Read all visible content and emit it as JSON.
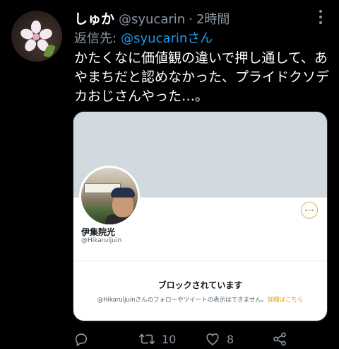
{
  "tweet": {
    "author_name": "しゅか",
    "author_handle": "@syucarin",
    "separator": "·",
    "time": "2時間",
    "reply_label": "返信先:",
    "reply_to": "@syucarinさん",
    "text": "かたくなに価値観の違いで押し通して、あやまちだと認めなかった、プライドクソデカおじさんやった…。",
    "avatar_icon": "cherry-blossom-icon"
  },
  "card": {
    "profile_name": "伊集院光",
    "profile_handle": "@Hikaruljuin",
    "blocked_title": "ブロックされています",
    "blocked_desc": "@Hikaruljuinさんのフォローやツイートの表示はできません。",
    "blocked_link": "詳細はこちら"
  },
  "actions": {
    "reply_icon": "reply-icon",
    "retweet_icon": "retweet-icon",
    "retweet_count": "10",
    "like_icon": "heart-icon",
    "like_count": "8",
    "share_icon": "share-icon"
  },
  "colors": {
    "background": "#000000",
    "secondary_text": "#8b98a5",
    "link": "#1d9bf0",
    "card_link": "#d4a017"
  }
}
